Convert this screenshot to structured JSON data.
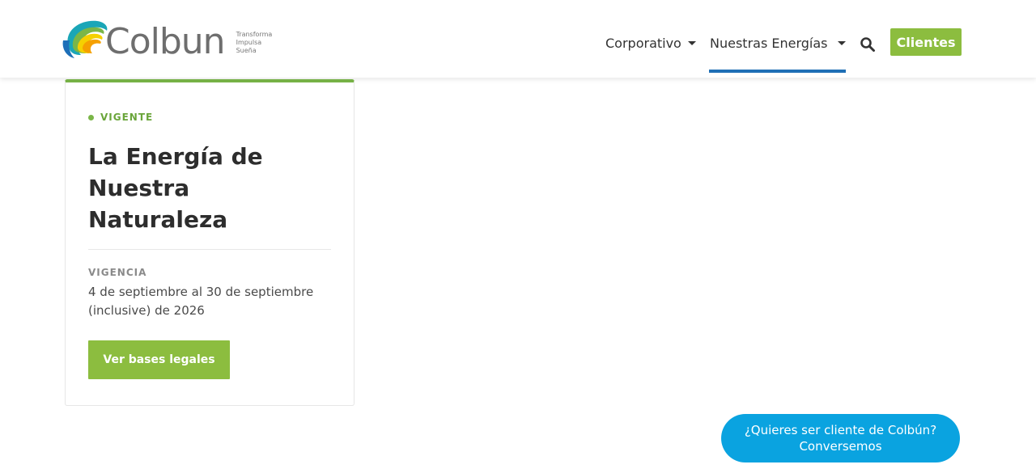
{
  "brand": {
    "name": "Colbun",
    "tagline": [
      "Transforma",
      "Impulsa",
      "Sueña"
    ],
    "colors": {
      "green": "#8cbd3f",
      "blue": "#1f6fb5",
      "chat_blue": "#0aa3e0",
      "logo_orange": "#f5a000",
      "logo_yellow": "#f5d000",
      "logo_teal": "#1aa6b7"
    }
  },
  "nav": {
    "items": [
      {
        "label": "Corporativo",
        "has_dropdown": true,
        "active": false
      },
      {
        "label": "Nuestras Energías",
        "has_dropdown": true,
        "active": true
      }
    ],
    "search_icon": "search-icon",
    "clientes_label": "Clientes"
  },
  "card": {
    "status": "VIGENTE",
    "title": "La Energía de Nuestra Naturaleza",
    "vigencia_label": "VIGENCIA",
    "vigencia_value": "4 de septiembre al 30 de septiembre (inclusive) de 2026",
    "button_label": "Ver bases legales"
  },
  "chat": {
    "line1": "¿Quieres ser cliente de Colbún?",
    "line2": "Conversemos"
  }
}
